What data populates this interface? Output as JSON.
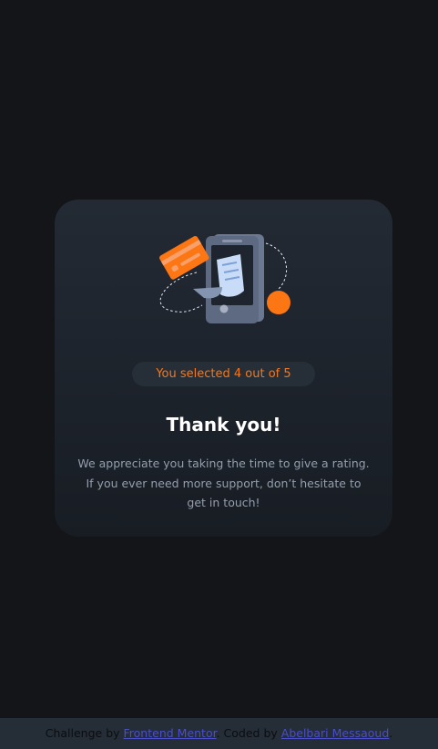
{
  "card": {
    "illustration_icon": "thank-you-illustration-icon",
    "selection_text": "You selected 4 out of 5",
    "title": "Thank you!",
    "message_line1": "We appreciate you taking the time to give a rating.",
    "message_line2": "If you ever need more support, don’t hesitate to",
    "message_line3": "get in touch!"
  },
  "footer": {
    "prefix": "Challenge by ",
    "challenge_link": "Frontend Mentor",
    "middle": ". Coded by ",
    "author_link": "Abelbari Messaoud",
    "suffix": "."
  },
  "colors": {
    "background": "#131518",
    "accent": "#fc7614",
    "card_top": "#232a34",
    "card_bottom": "#181d24",
    "text_muted": "#959eac",
    "link": "#4a4ec9",
    "footer_bg": "#252d37"
  }
}
